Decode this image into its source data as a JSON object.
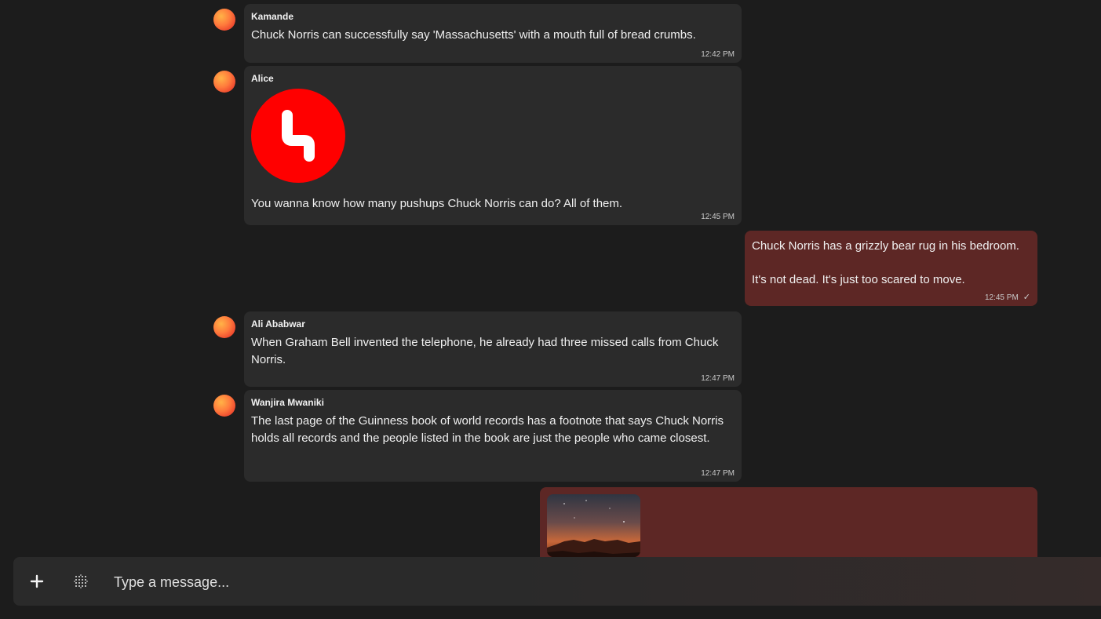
{
  "messages": [
    {
      "sender": "Kamande",
      "text": "Chuck Norris can successfully say 'Massachusetts' with a mouth full of bread crumbs.",
      "time": "12:42 PM"
    },
    {
      "sender": "Alice",
      "text": "You wanna know how many pushups Chuck Norris can do? All of them.",
      "time": "12:45 PM",
      "sticker_color": "#ff0000"
    },
    {
      "sender": "",
      "text": "Chuck Norris has a grizzly bear rug in his bedroom.\n\nIt's not dead. It's just too scared to move.",
      "time": "12:45 PM",
      "status_icon": "single-check-icon"
    },
    {
      "sender": "Ali Ababwar",
      "text": "When Graham Bell invented the telephone, he already had three missed calls from Chuck Norris.",
      "time": "12:47 PM"
    },
    {
      "sender": "Wanjira Mwaniki",
      "text": "The last page of the Guinness book of world records has a footnote that says Chuck Norris holds all records and the people listed in the book are just the people who came closest.",
      "time": "12:47 PM"
    }
  ],
  "composer": {
    "placeholder": "Type a message...",
    "add_icon": "plus-icon",
    "sticker_icon": "dot-grid-icon"
  },
  "colors": {
    "background": "#1c1c1c",
    "incoming_bubble": "#2b2b2b",
    "outgoing_bubble": "#5d2725",
    "sticker": "#ff0000"
  }
}
